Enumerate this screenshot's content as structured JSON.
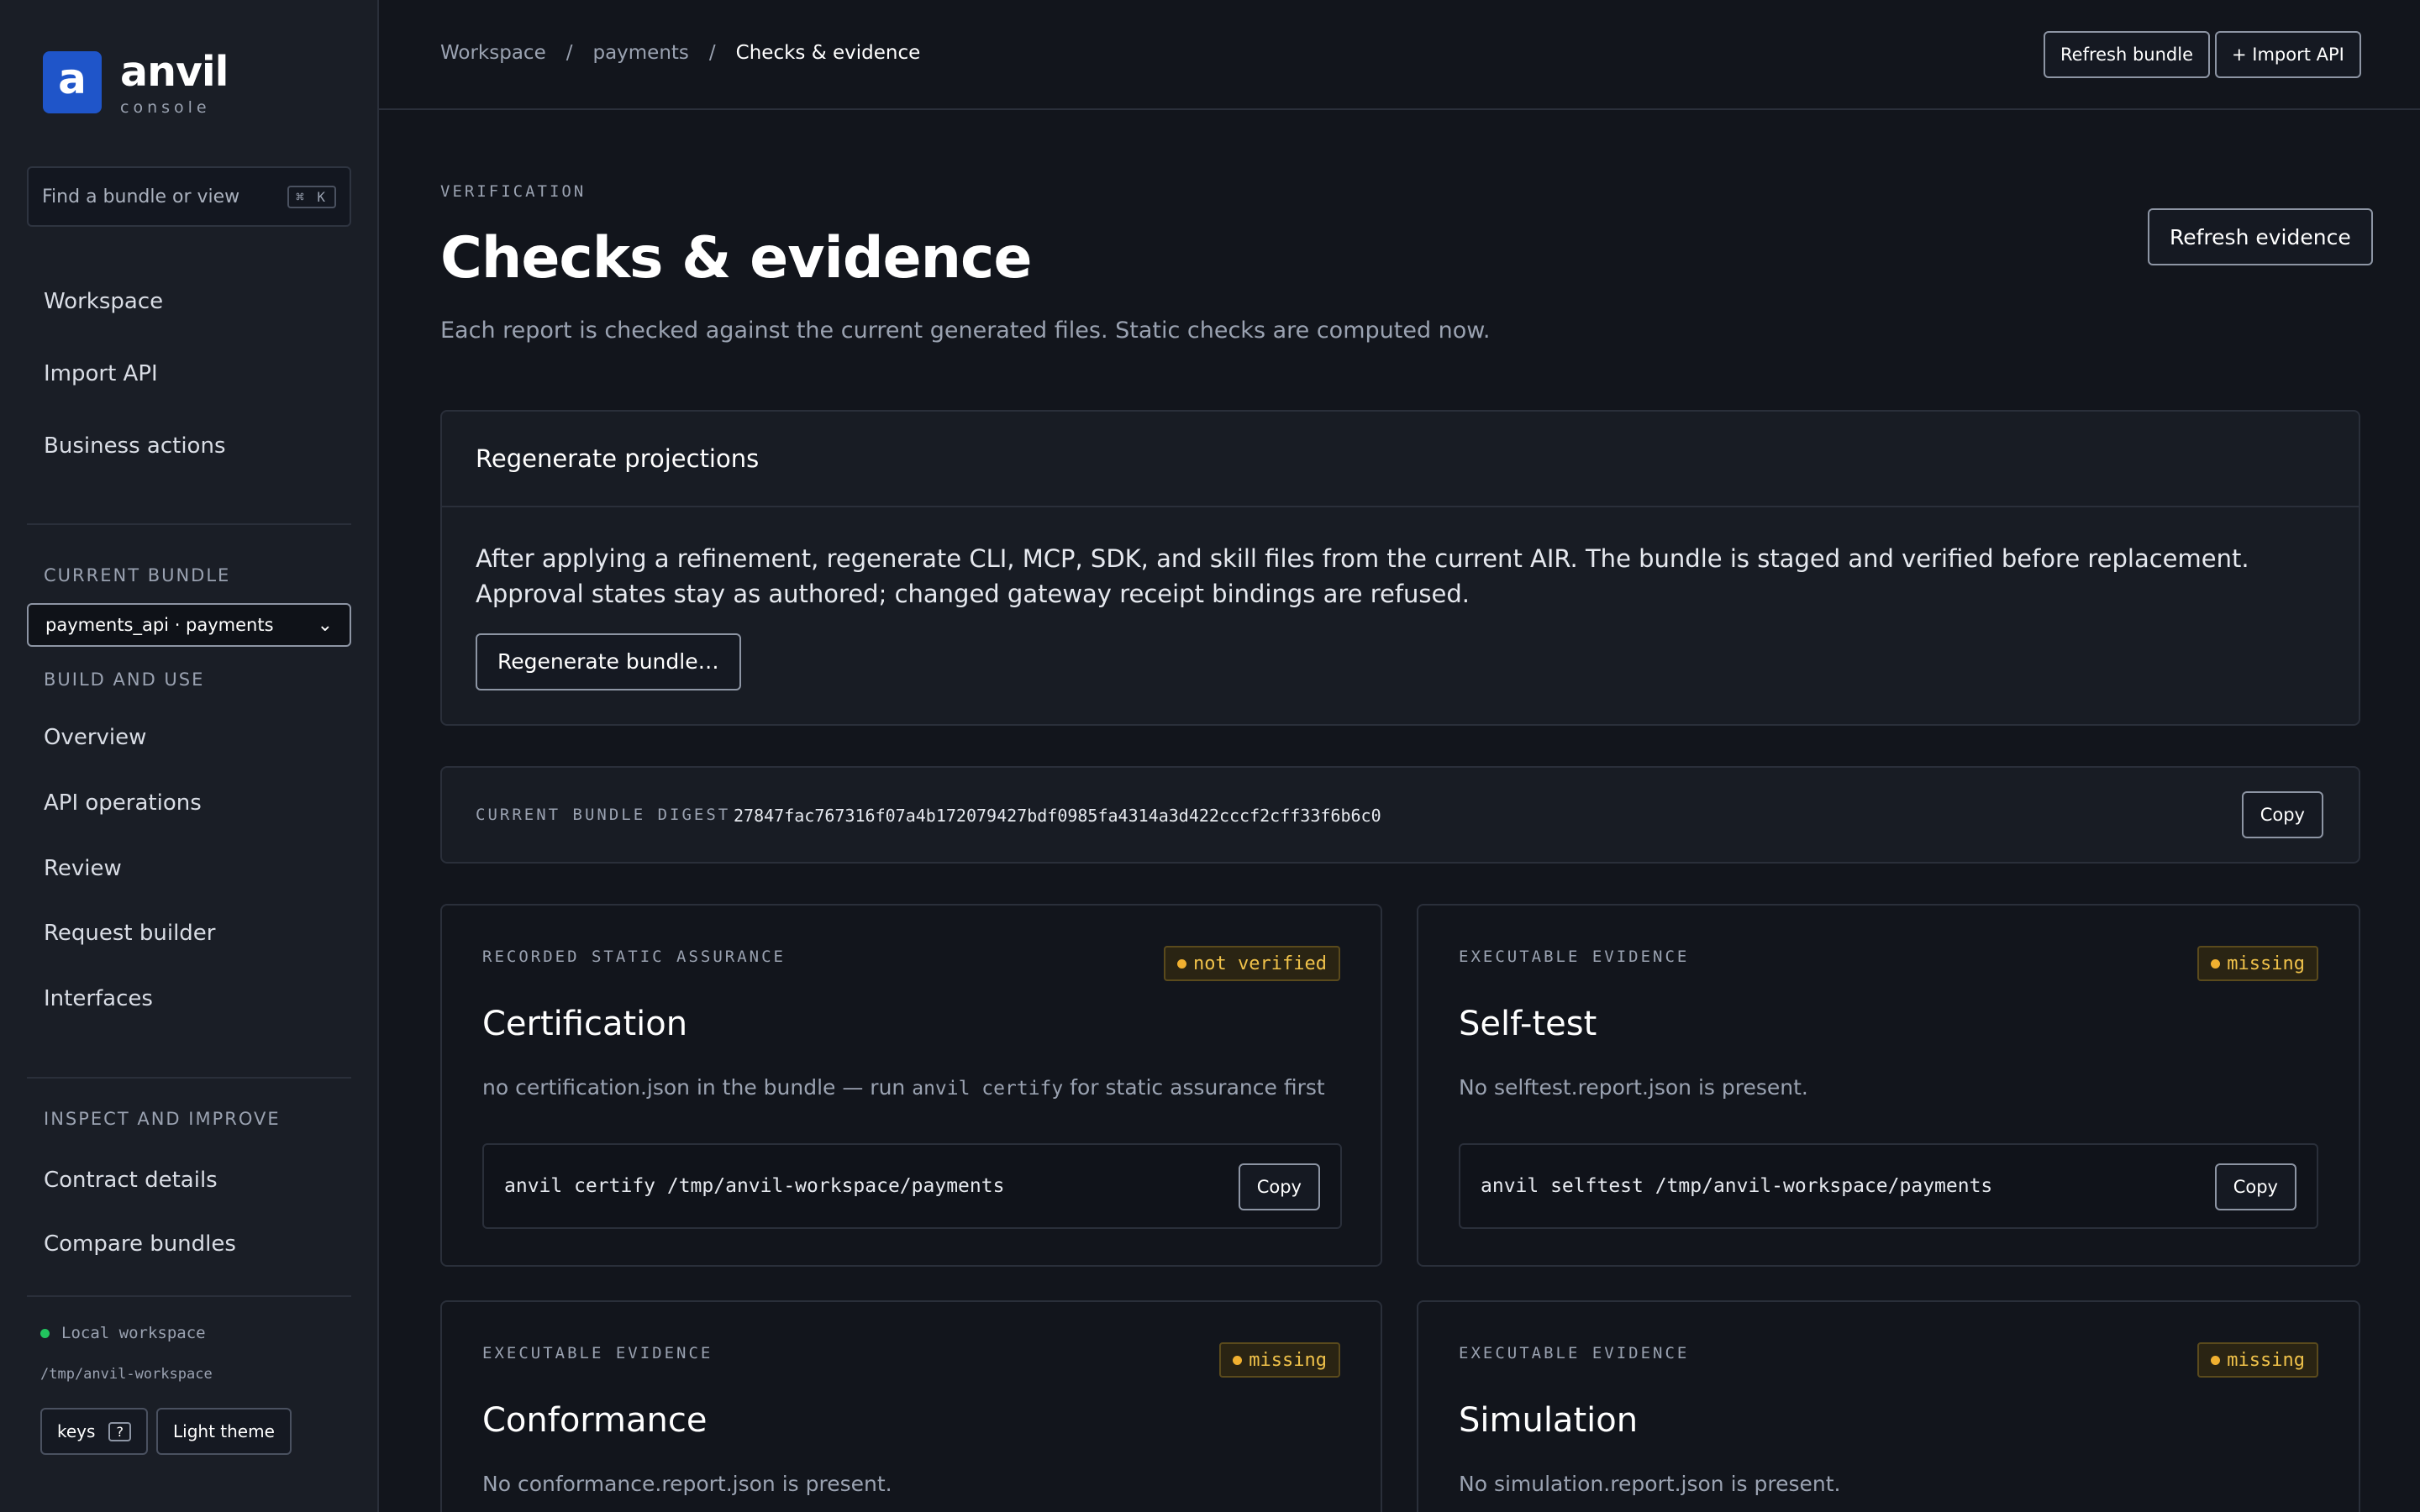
{
  "brand": {
    "mark": "a",
    "name": "anvil",
    "sub": "console"
  },
  "search": {
    "placeholder": "Find a bundle or view",
    "shortcut": "⌘ K"
  },
  "nav_top": [
    "Workspace",
    "Import API",
    "Business actions"
  ],
  "current_bundle": {
    "label": "CURRENT BUNDLE",
    "value": "payments_api · payments"
  },
  "build_and_use": {
    "label": "BUILD AND USE",
    "items": [
      "Overview",
      "API operations",
      "Review",
      "Request builder",
      "Interfaces"
    ]
  },
  "inspect_and_improve": {
    "label": "INSPECT AND IMPROVE",
    "items": [
      "Contract details",
      "Compare bundles"
    ]
  },
  "workspace_footer": {
    "status": "Local workspace",
    "path": "/tmp/anvil-workspace",
    "keys_label": "keys",
    "keys_shortcut": "?",
    "theme_label": "Light theme"
  },
  "breadcrumb": {
    "root": "Workspace",
    "mid": "payments",
    "current": "Checks & evidence",
    "sep": "/"
  },
  "topbar": {
    "refresh_bundle": "Refresh bundle",
    "import_api": "+ Import API"
  },
  "header": {
    "eyebrow": "VERIFICATION",
    "title": "Checks & evidence",
    "subtitle": "Each report is checked against the current generated files. Static checks are computed now.",
    "refresh_evidence": "Refresh evidence"
  },
  "regenerate": {
    "title": "Regenerate projections",
    "body": "After applying a refinement, regenerate CLI, MCP, SDK, and skill files from the current AIR. The bundle is staged and verified before replacement. Approval states stay as authored; changed gateway receipt bindings are refused.",
    "button": "Regenerate bundle…"
  },
  "digest": {
    "label": "CURRENT BUNDLE DIGEST",
    "value": "27847fac767316f07a4b172079427bdf0985fa4314a3d422cccf2cff33f6b6c0",
    "copy": "Copy"
  },
  "cards": [
    {
      "eyebrow": "RECORDED STATIC ASSURANCE",
      "badge": "not verified",
      "title": "Certification",
      "desc_pre": "no certification.json in the bundle — run ",
      "desc_code": "anvil certify",
      "desc_post": " for static assurance first",
      "command": "anvil certify /tmp/anvil-workspace/payments",
      "copy": "Copy"
    },
    {
      "eyebrow": "EXECUTABLE EVIDENCE",
      "badge": "missing",
      "title": "Self-test",
      "desc": "No selftest.report.json is present.",
      "command": "anvil selftest /tmp/anvil-workspace/payments",
      "copy": "Copy"
    },
    {
      "eyebrow": "EXECUTABLE EVIDENCE",
      "badge": "missing",
      "title": "Conformance",
      "desc": "No conformance.report.json is present."
    },
    {
      "eyebrow": "EXECUTABLE EVIDENCE",
      "badge": "missing",
      "title": "Simulation",
      "desc": "No simulation.report.json is present."
    }
  ]
}
